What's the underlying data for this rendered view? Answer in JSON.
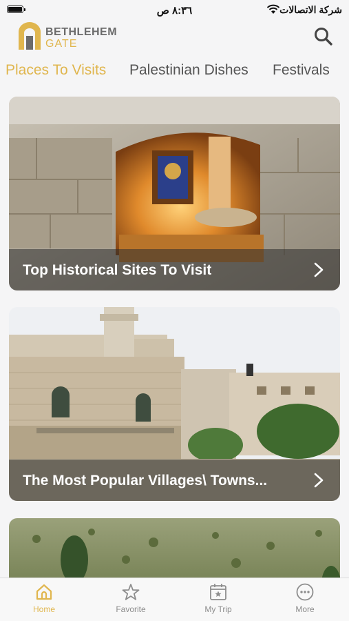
{
  "status_bar": {
    "time": "٨:٣٦ ص",
    "carrier": "شركة الاتصالات"
  },
  "header": {
    "brand_line1": "BETHLEHEM",
    "brand_line2": "GATE"
  },
  "tabs": [
    {
      "label": "Places To Visits",
      "active": true
    },
    {
      "label": "Palestinian Dishes",
      "active": false
    },
    {
      "label": "Festivals",
      "active": false
    }
  ],
  "cards": [
    {
      "title": "Top Historical Sites To Visit"
    },
    {
      "title": "The Most Popular Villages\\ Towns..."
    },
    {
      "title": ""
    }
  ],
  "tab_bar": [
    {
      "label": "Home",
      "icon": "home-icon",
      "active": true
    },
    {
      "label": "Favorite",
      "icon": "star-icon",
      "active": false
    },
    {
      "label": "My Trip",
      "icon": "calendar-star-icon",
      "active": false
    },
    {
      "label": "More",
      "icon": "more-dots-icon",
      "active": false
    }
  ],
  "colors": {
    "accent": "#e0b64e",
    "inactive": "#8d8d8d"
  }
}
